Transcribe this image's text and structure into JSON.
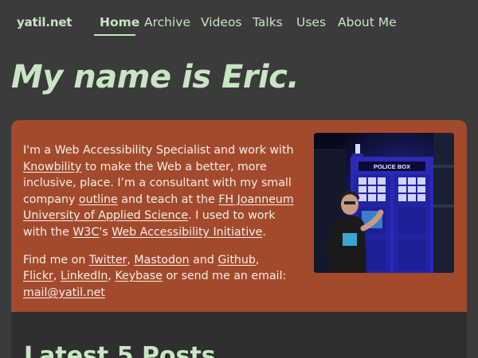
{
  "site": {
    "logo": "yatil.net"
  },
  "nav": {
    "items": [
      {
        "label": "Home",
        "active": true
      },
      {
        "label": "Archive"
      },
      {
        "label": "Videos"
      },
      {
        "label": "Talks"
      },
      {
        "label": "Uses"
      },
      {
        "label": "About Me"
      }
    ]
  },
  "hero": {
    "title": "My name is Eric."
  },
  "intro": {
    "p1": {
      "t1": "I'm a Web Accessibility Specialist and work with ",
      "link_knowbility": "Knowbility",
      "t2": " to make the Web a better, more inclusive, place. I’m a consultant with my small company ",
      "link_outline": "outline",
      "t3": " and teach at the ",
      "link_fh": "FH Joanneum University of Applied Science",
      "t4": ". I used to work with the ",
      "link_w3c": "W3C",
      "t5": "'s ",
      "link_wai": "Web Accessibility Initiative",
      "t6": "."
    },
    "p2": {
      "t1": "Find me on ",
      "link_twitter": "Twitter",
      "sep1": ", ",
      "link_mastodon": "Mastodon",
      "t2": " and ",
      "link_github": "Github",
      "sep2": ",",
      "link_flickr": "Flickr",
      "sep3": ", ",
      "link_linkedin": "LinkedIn",
      "sep4": ", ",
      "link_keybase": "Keybase",
      "t3": " or send me an email: ",
      "link_email": "mail@yatil.net"
    },
    "photo_sign": "POLICE BOX"
  },
  "posts": {
    "heading": "Latest 5 Posts"
  },
  "colors": {
    "background": "#3b3b3b",
    "accent_green": "#c8e6c3",
    "card": "#a34a2c",
    "card_text": "#f3efe8"
  }
}
